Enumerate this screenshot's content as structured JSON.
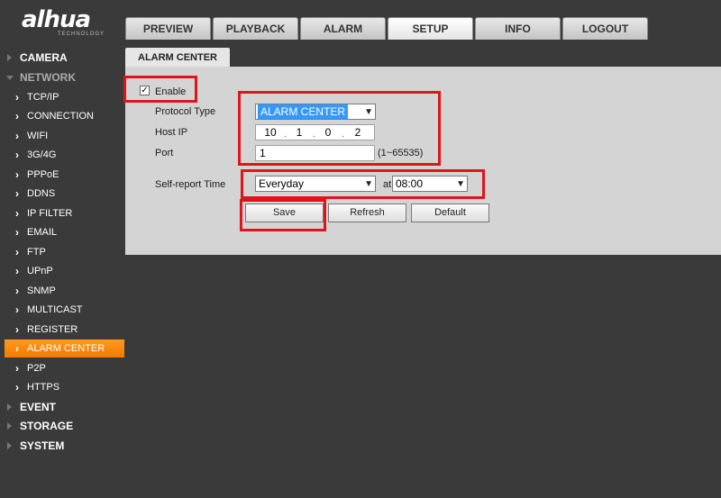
{
  "brand": {
    "logo": "alhua",
    "tagline": "TECHNOLOGY"
  },
  "tabs": [
    {
      "label": "PREVIEW"
    },
    {
      "label": "PLAYBACK"
    },
    {
      "label": "ALARM"
    },
    {
      "label": "SETUP",
      "active": true
    },
    {
      "label": "INFO"
    },
    {
      "label": "LOGOUT"
    }
  ],
  "sidebar": {
    "camera": "CAMERA",
    "network": "NETWORK",
    "network_items": [
      "TCP/IP",
      "CONNECTION",
      "WIFI",
      "3G/4G",
      "PPPoE",
      "DDNS",
      "IP FILTER",
      "EMAIL",
      "FTP",
      "UPnP",
      "SNMP",
      "MULTICAST",
      "REGISTER",
      "ALARM CENTER",
      "P2P",
      "HTTPS"
    ],
    "active_item": "ALARM CENTER",
    "event": "EVENT",
    "storage": "STORAGE",
    "system": "SYSTEM"
  },
  "page": {
    "title": "ALARM CENTER",
    "enable_label": "Enable",
    "enable_checked": "✓",
    "protocol_label": "Protocol Type",
    "protocol_value": "ALARM CENTER",
    "host_label": "Host IP",
    "host_ip": [
      "10",
      "1",
      "0",
      "2"
    ],
    "port_label": "Port",
    "port_value": "1",
    "port_range": "(1~65535)",
    "self_report_label": "Self-report Time",
    "self_report_value": "Everyday",
    "at_label": "at",
    "time_value": "08:00",
    "save": "Save",
    "refresh": "Refresh",
    "default": "Default"
  },
  "colors": {
    "highlight": "#e1141c",
    "active_nav": "#f27a00",
    "select_highlight": "#3399ff"
  }
}
